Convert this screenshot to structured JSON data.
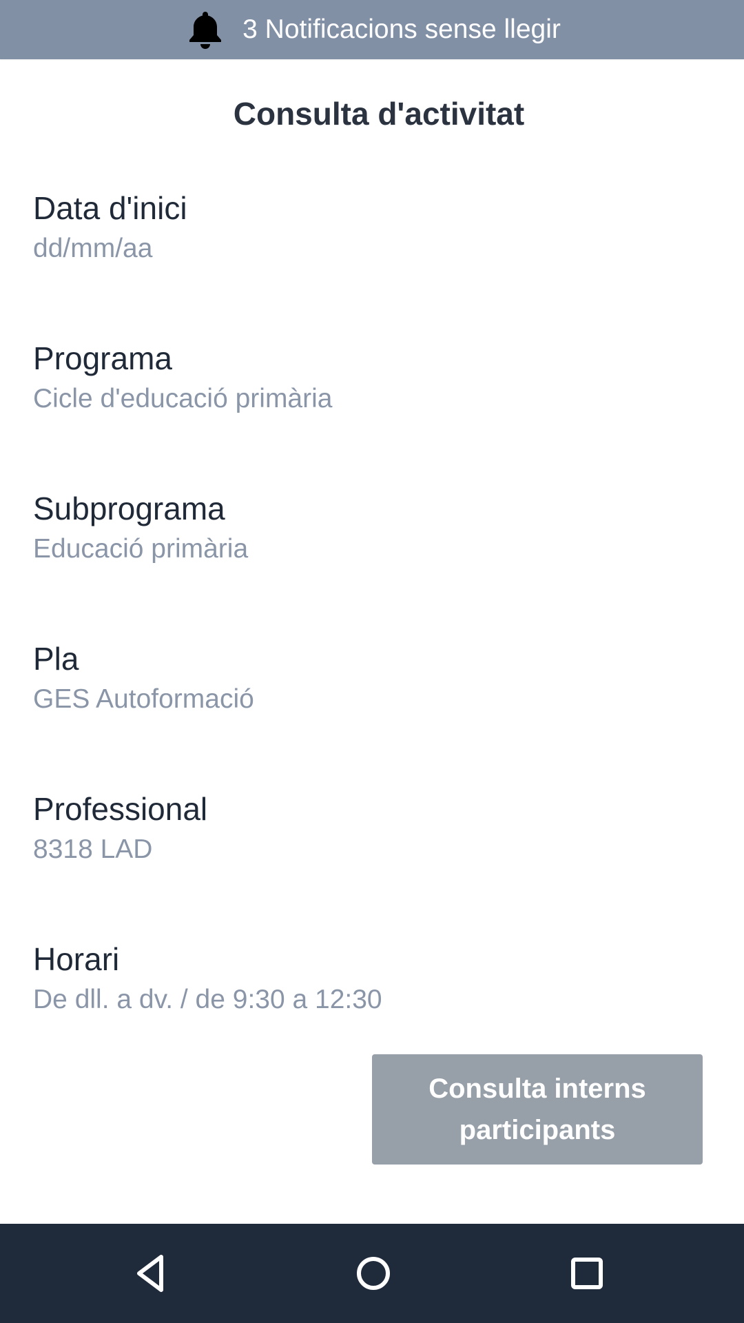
{
  "notification_bar": {
    "icon": "bell-icon",
    "text": "3 Notificacions sense llegir"
  },
  "page": {
    "title": "Consulta d'activitat"
  },
  "fields": [
    {
      "label": "Data d'inici",
      "value": "dd/mm/aa"
    },
    {
      "label": "Programa",
      "value": "Cicle d'educació primària"
    },
    {
      "label": "Subprograma",
      "value": "Educació primària"
    },
    {
      "label": "Pla",
      "value": "GES Autoformació"
    },
    {
      "label": "Professional",
      "value": "8318 LAD"
    },
    {
      "label": "Horari",
      "value": "De dll. a dv. / de 9:30 a 12:30"
    }
  ],
  "actions": {
    "consulta_interns_label": "Consulta interns participants"
  },
  "system_nav": {
    "back_icon": "back-triangle-icon",
    "home_icon": "home-circle-icon",
    "recents_icon": "recents-square-icon"
  },
  "colors": {
    "notification_bar": "#8290a6",
    "title_text": "#2b3340",
    "label_text": "#1f2937",
    "value_text": "#8a96a8",
    "button_disabled": "#979fa9",
    "nav_bar": "#1f2a3b"
  }
}
